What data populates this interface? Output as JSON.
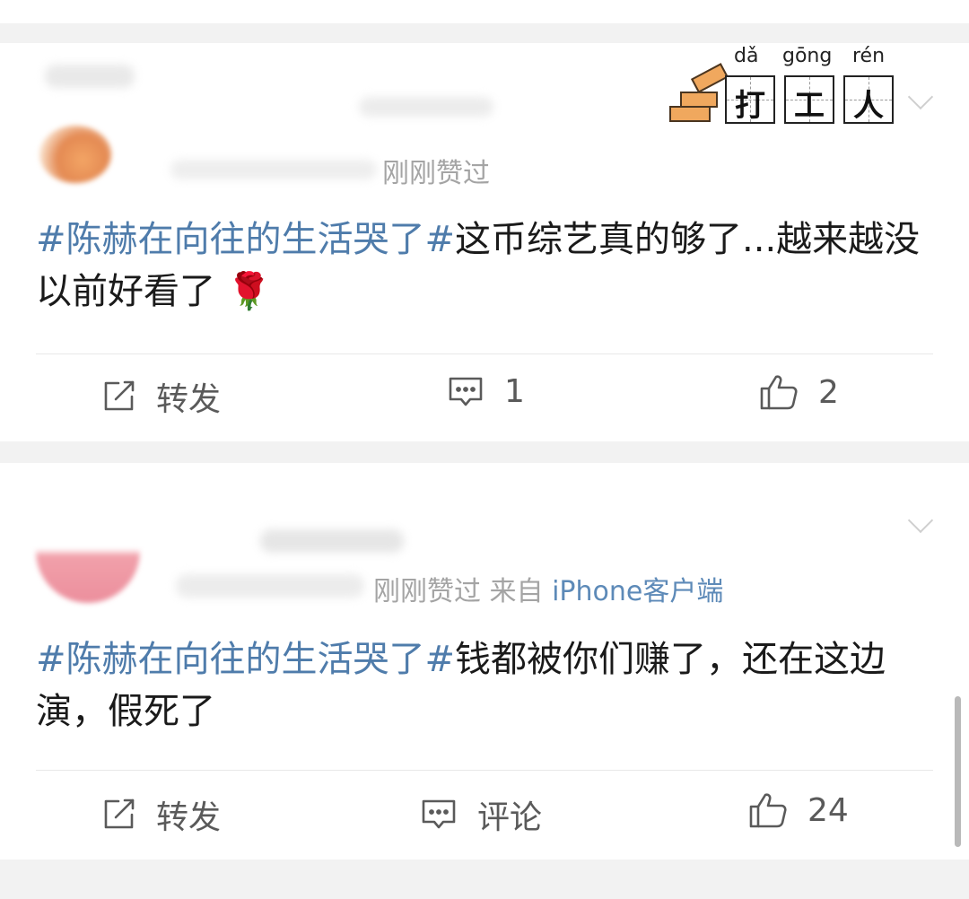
{
  "badge": {
    "pinyin": [
      "dǎ",
      "gōng",
      "rén"
    ],
    "chars": [
      "打",
      "工",
      "人"
    ]
  },
  "post1": {
    "meta": "刚刚赞过",
    "hashtag": "#陈赫在向往的生活哭了#",
    "text": "这币综艺真的够了...越来越没以前好看了",
    "emoji": "🌹",
    "actions": {
      "forward_label": "转发",
      "comment_label": "1",
      "like_label": "2"
    }
  },
  "post2": {
    "meta_prefix": "刚刚赞过  来自 ",
    "source": "iPhone客户端",
    "hashtag": "#陈赫在向往的生活哭了#",
    "text": "钱都被你们赚了，还在这边演，假死了",
    "actions": {
      "forward_label": "转发",
      "comment_label": "评论",
      "like_label": "24"
    }
  },
  "icons": {
    "forward": "share-edit-icon",
    "comment": "comment-bubble-icon",
    "like": "thumbs-up-icon",
    "more": "chevron-down-icon"
  },
  "colors": {
    "hashtag": "#4f7cab",
    "meta": "#a4a4a4",
    "text": "#1a1a1a",
    "action": "#5a5a5a",
    "background": "#f2f2f2"
  }
}
